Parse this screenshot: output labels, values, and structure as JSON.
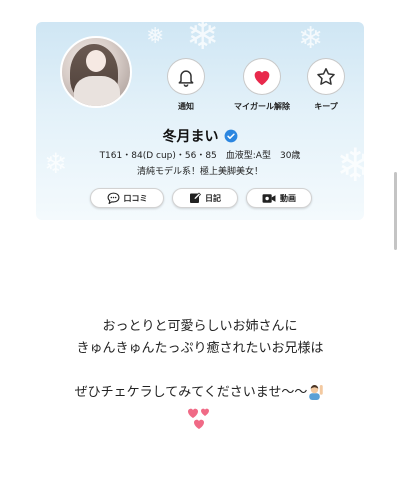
{
  "profile": {
    "name": "冬月まい",
    "stats": "T161・84(D cup)・56・85　血液型:A型　30歳",
    "catchphrase": "清純モデル系！極上美脚美女！",
    "actions": [
      {
        "label": "通知",
        "icon": "bell-icon"
      },
      {
        "label": "マイガール解除",
        "icon": "heart-icon",
        "color": "#e8294c"
      },
      {
        "label": "キープ",
        "icon": "star-icon"
      }
    ],
    "tabs": [
      {
        "label": "口コミ",
        "icon": "speech-bubble-icon"
      },
      {
        "label": "日記",
        "icon": "edit-icon"
      },
      {
        "label": "動画",
        "icon": "video-camera-icon"
      }
    ],
    "verified_color": "#2b86e0"
  },
  "message": {
    "line1": "おっとりと可愛らしいお姉さんに",
    "line2": "きゅんきゅんたっぷり癒されたいお兄様は",
    "line3": "ぜひチェケラしてみてくださいませ〜〜"
  },
  "colors": {
    "card_top": "#cfe6f4",
    "heart": "#e8294c",
    "hearts_emoji": "#f06a86"
  }
}
